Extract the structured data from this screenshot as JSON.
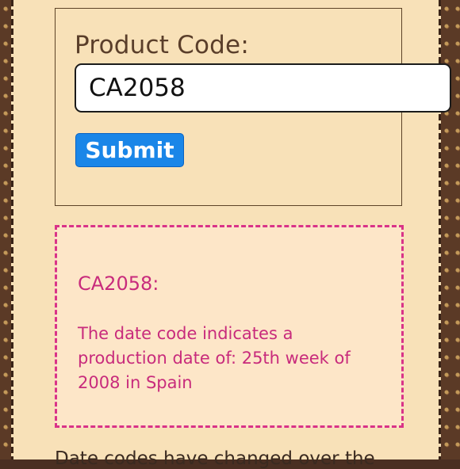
{
  "form": {
    "label": "Product Code:",
    "input_value": "CA2058",
    "submit_label": "Submit"
  },
  "result": {
    "title": "CA2058:",
    "text": "The date code indicates a production date of: 25th week of 2008 in Spain"
  },
  "footer": {
    "partial_text": "Date codes have changed over the"
  },
  "colors": {
    "page_background": "#f8e1b8",
    "result_background": "#fde6c8",
    "result_text": "#c82b7c",
    "result_border": "#d93388",
    "submit_button": "#1a86e8"
  }
}
